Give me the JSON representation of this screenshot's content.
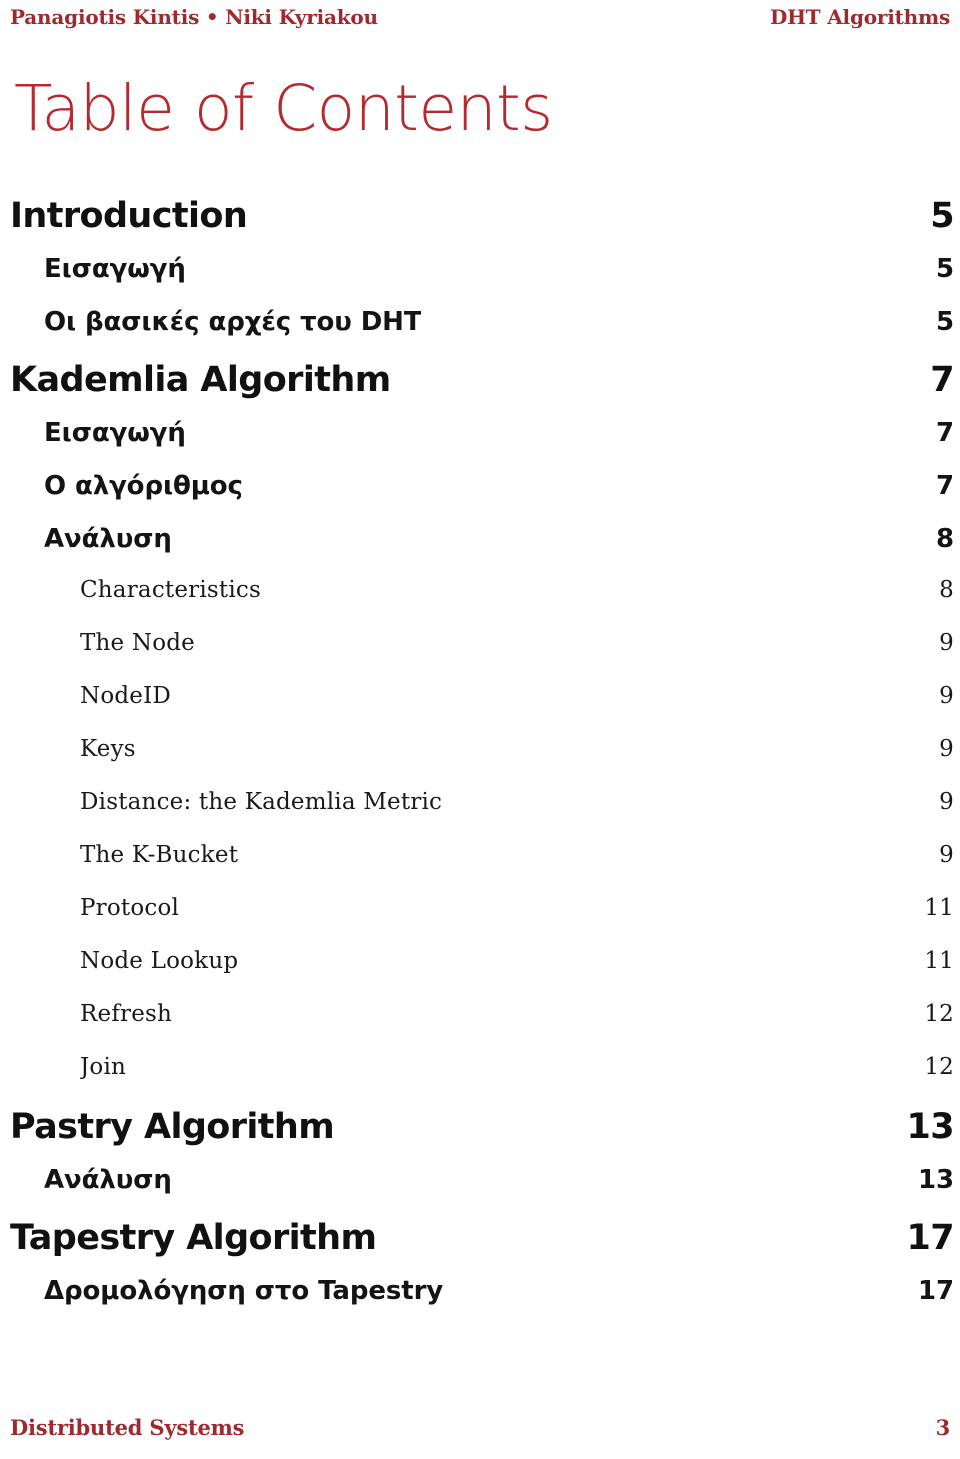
{
  "header": {
    "authors": "Panagiotis Kintis • Niki Kyriakou",
    "document_title": "DHT Algorithms"
  },
  "title": "Table of Contents",
  "colors": {
    "accent_red": "#9E2A30",
    "title_red": "#B42A2E",
    "text_black": "#111111",
    "page_background": "#FFFFFF"
  },
  "toc": {
    "entries": [
      {
        "level": 1,
        "label": "Introduction",
        "page": "5"
      },
      {
        "level": 2,
        "label": "Εισαγωγή",
        "page": "5"
      },
      {
        "level": 2,
        "label": "Οι βασικές αρχές του DHT",
        "page": "5"
      },
      {
        "level": 1,
        "label": "Kademlia Algorithm",
        "page": "7"
      },
      {
        "level": 2,
        "label": "Εισαγωγή",
        "page": "7"
      },
      {
        "level": 2,
        "label": "Ο αλγόριθμος",
        "page": "7"
      },
      {
        "level": 2,
        "label": "Ανάλυση",
        "page": "8"
      },
      {
        "level": 3,
        "label": "Characteristics",
        "page": "8"
      },
      {
        "level": 3,
        "label": "The Node",
        "page": "9"
      },
      {
        "level": 3,
        "label": "NodeID",
        "page": "9"
      },
      {
        "level": 3,
        "label": "Keys",
        "page": "9"
      },
      {
        "level": 3,
        "label": "Distance: the Kademlia Metric",
        "page": "9"
      },
      {
        "level": 3,
        "label": "The K-Bucket",
        "page": "9"
      },
      {
        "level": 3,
        "label": "Protocol",
        "page": "11"
      },
      {
        "level": 3,
        "label": "Node Lookup",
        "page": "11"
      },
      {
        "level": 3,
        "label": "Refresh",
        "page": "12"
      },
      {
        "level": 3,
        "label": "Join",
        "page": "12"
      },
      {
        "level": 1,
        "label": "Pastry Algorithm",
        "page": "13"
      },
      {
        "level": 2,
        "label": "Ανάλυση",
        "page": "13"
      },
      {
        "level": 1,
        "label": "Tapestry Algorithm",
        "page": "17"
      },
      {
        "level": 2,
        "label": "Δρομολόγηση στο Tapestry",
        "page": "17"
      }
    ]
  },
  "footer": {
    "course": "Distributed Systems",
    "page_number": "3"
  }
}
